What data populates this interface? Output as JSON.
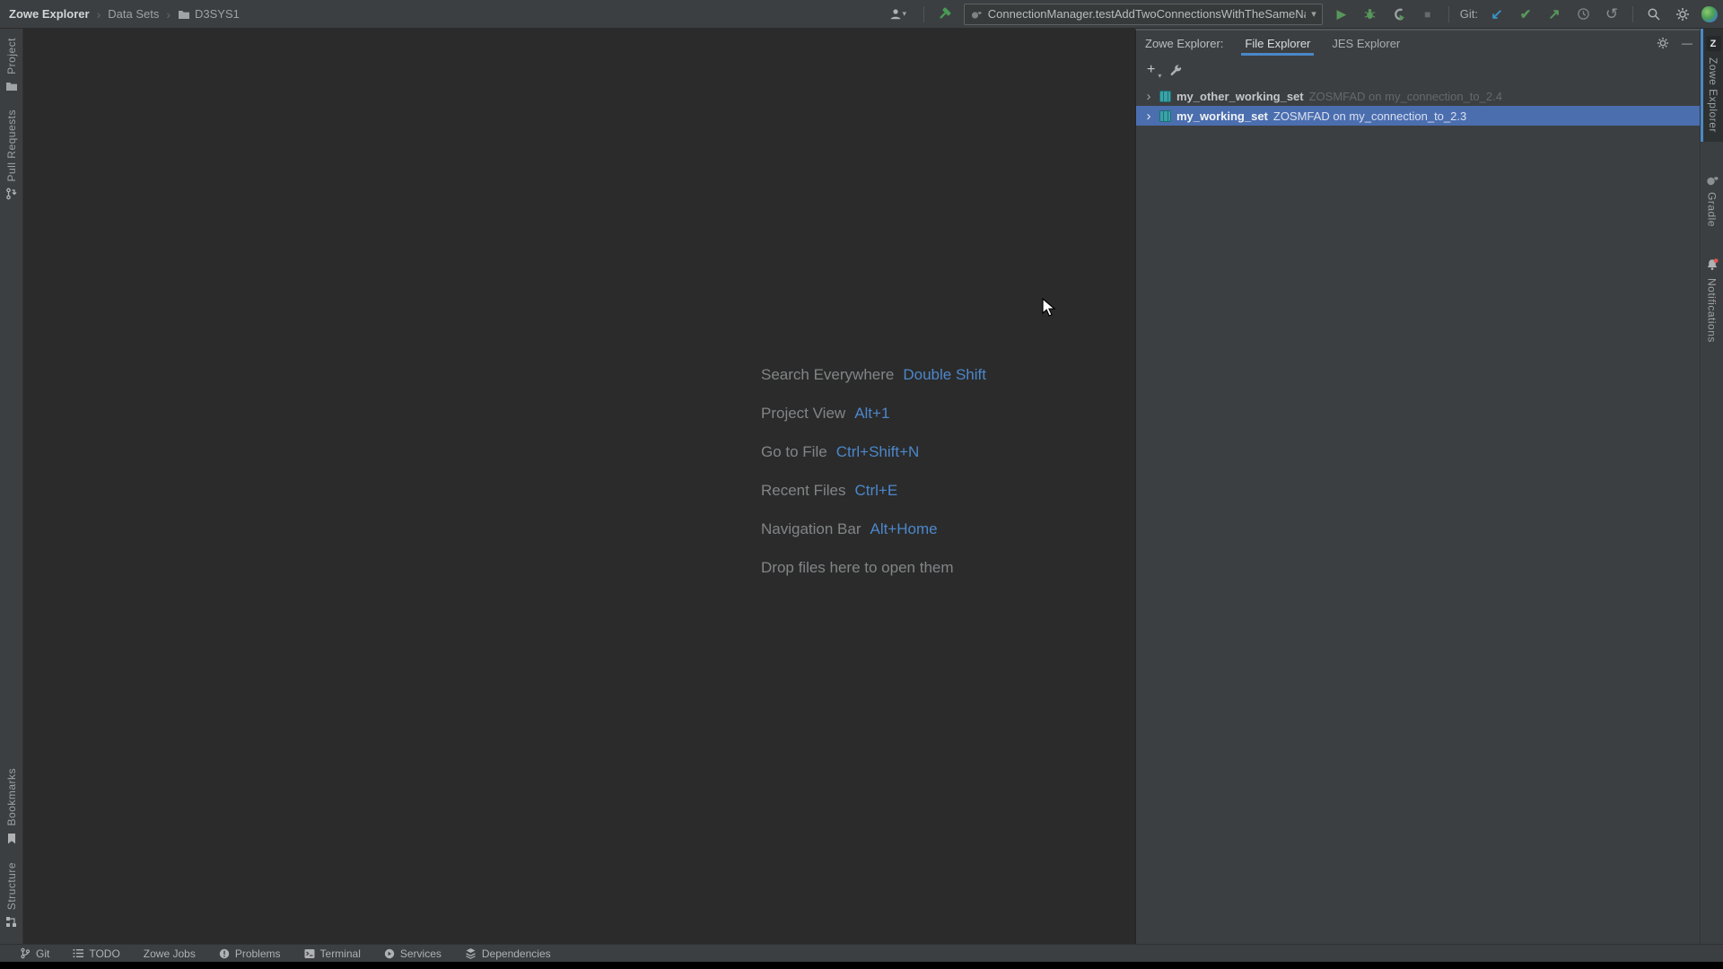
{
  "breadcrumb": {
    "items": [
      "Zowe Explorer",
      "Data Sets",
      "D3SYS1"
    ]
  },
  "top_toolbar": {
    "run_config": "ConnectionManager.testAddTwoConnectionsWithTheSameName",
    "git_label": "Git:"
  },
  "rails": {
    "left": [
      {
        "label": "Project"
      },
      {
        "label": "Pull Requests"
      },
      {
        "label": "Bookmarks"
      },
      {
        "label": "Structure"
      }
    ],
    "right": [
      {
        "label": "Zowe Explorer",
        "badge": "Z"
      },
      {
        "label": "Gradle"
      },
      {
        "label": "Notifications"
      }
    ]
  },
  "editor": {
    "shortcuts": [
      {
        "label": "Search Everywhere",
        "shortcut": "Double Shift"
      },
      {
        "label": "Project View",
        "shortcut": "Alt+1"
      },
      {
        "label": "Go to File",
        "shortcut": "Ctrl+Shift+N"
      },
      {
        "label": "Recent Files",
        "shortcut": "Ctrl+E"
      },
      {
        "label": "Navigation Bar",
        "shortcut": "Alt+Home"
      }
    ],
    "drop_hint": "Drop files here to open them"
  },
  "tool_window": {
    "title": "Zowe Explorer:",
    "tabs": [
      {
        "label": "File Explorer",
        "active": true
      },
      {
        "label": "JES Explorer",
        "active": false
      }
    ],
    "tree": [
      {
        "name": "my_other_working_set",
        "detail": "ZOSMFAD on my_connection_to_2.4",
        "selected": false
      },
      {
        "name": "my_working_set",
        "detail": "ZOSMFAD on my_connection_to_2.3",
        "selected": true
      }
    ]
  },
  "status_bar": {
    "items": [
      "Git",
      "TODO",
      "Zowe Jobs",
      "Problems",
      "Terminal",
      "Services",
      "Dependencies"
    ]
  },
  "icons": {
    "play": "▶",
    "stop": "■",
    "commit_check": "✔",
    "update_arrow": "↙",
    "push_arrow": "↗",
    "rollback": "↺",
    "caret_down": "▾",
    "chevron": "›",
    "breadcrumb_sep": "›",
    "add": "+",
    "minimize": "—"
  },
  "colors": {
    "chrome_bg": "#3C3F41",
    "editor_bg": "#2B2B2B",
    "selection_blue": "#4B6EAF",
    "tab_underline": "#4A88C7",
    "shortcut_blue": "#4C87CB",
    "run_green": "#57965C",
    "git_update_blue": "#3592C4",
    "working_set_teal": "#3BA3A8",
    "notification_red": "#E05555"
  }
}
